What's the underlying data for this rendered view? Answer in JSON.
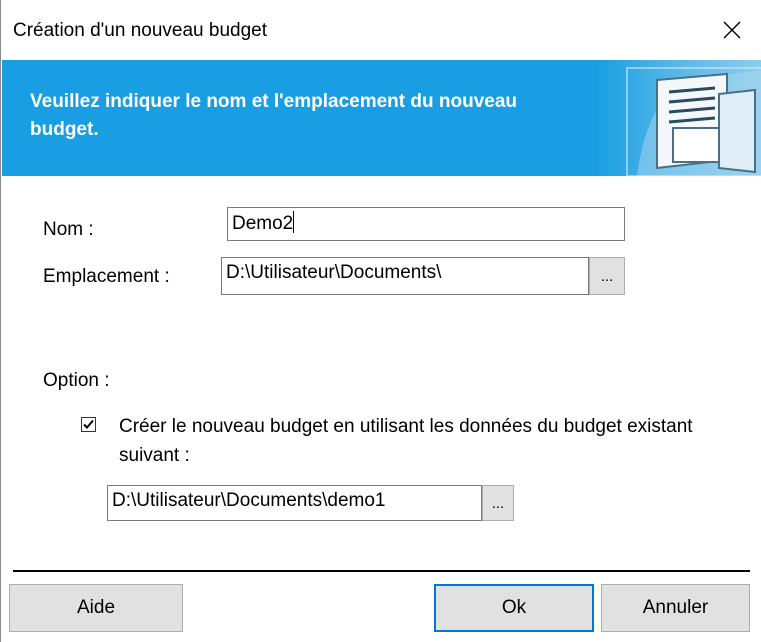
{
  "dialog": {
    "title": "Création d'un nouveau budget",
    "close_icon": "×"
  },
  "banner": {
    "text": "Veuillez indiquer le nom et l'emplacement du nouveau budget.",
    "accent_color": "#1a9ee3"
  },
  "form": {
    "name_label": "Nom :",
    "name_value": "Demo2",
    "location_label": "Emplacement :",
    "location_value": "D:\\Utilisateur\\Documents\\",
    "browse_label": "...",
    "option_label": "Option :",
    "use_existing_checked": true,
    "use_existing_label": "Créer le nouveau budget en utilisant les données du budget existant suivant :",
    "existing_path_value": "D:\\Utilisateur\\Documents\\demo1",
    "existing_browse_label": "..."
  },
  "buttons": {
    "help": "Aide",
    "ok": "Ok",
    "cancel": "Annuler"
  }
}
